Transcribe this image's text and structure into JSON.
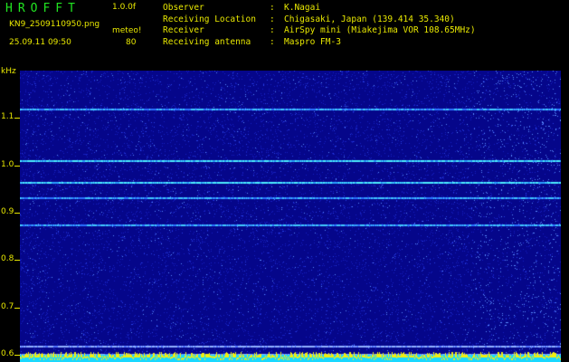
{
  "header": {
    "app_title": "HROFFT",
    "version": "1.0.0f",
    "filename": "KN9_2509110950.png",
    "meteo_label": "meteo!",
    "datetime": "25.09.11 09:50",
    "count": "80"
  },
  "info": [
    {
      "key": "Observer",
      "value": "K.Nagai"
    },
    {
      "key": "Receiving Location",
      "value": "Chigasaki, Japan (139.414 35.340)"
    },
    {
      "key": "Receiver",
      "value": "AirSpy mini (Miakejima VOR 108.65MHz)"
    },
    {
      "key": "Receiving antenna",
      "value": "Maspro FM-3"
    }
  ],
  "chart_data": {
    "type": "heatmap",
    "ylabel": "kHz",
    "y_ticks": [
      {
        "value": 1.1,
        "label": "1.1"
      },
      {
        "value": 1.0,
        "label": "1.0"
      },
      {
        "value": 0.9,
        "label": "0.9"
      },
      {
        "value": 0.8,
        "label": "0.8"
      },
      {
        "value": 0.7,
        "label": "0.7"
      },
      {
        "value": 0.6,
        "label": "0.6"
      }
    ],
    "ylim": [
      0.585,
      1.2
    ],
    "x_ticks": [
      "0951",
      "0952",
      "0953",
      "0954",
      "0955",
      "0956",
      "0957",
      "0958",
      "0959",
      "1000"
    ],
    "bands_khz": [
      1.12,
      1.01,
      0.965,
      0.932,
      0.875,
      0.62,
      0.603
    ],
    "colors": {
      "background": "#05068a",
      "signal": "#4cf0ff",
      "text": "#e8e800",
      "title": "#21e421"
    }
  }
}
